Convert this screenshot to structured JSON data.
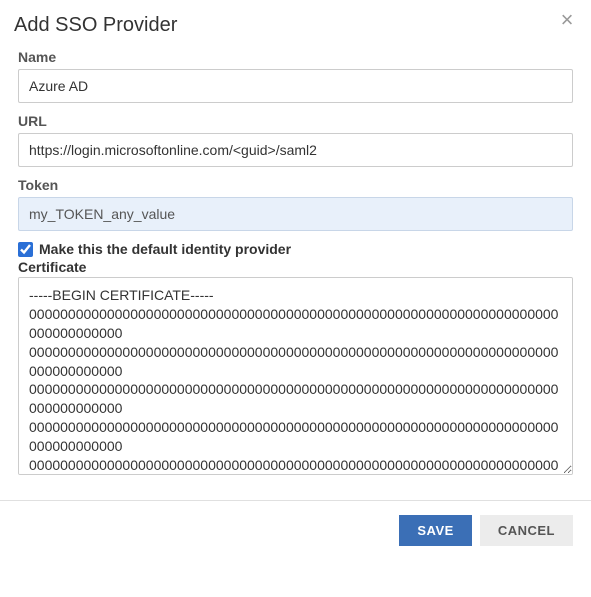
{
  "dialog": {
    "title": "Add SSO Provider"
  },
  "form": {
    "name_label": "Name",
    "name_value": "Azure AD",
    "url_label": "URL",
    "url_value": "https://login.microsoftonline.com/<guid>/saml2",
    "token_label": "Token",
    "token_value": "my_TOKEN_any_value",
    "default_checkbox_label": "Make this the default identity provider",
    "default_checked": true,
    "certificate_label": "Certificate",
    "certificate_value": "-----BEGIN CERTIFICATE-----\n00000000000000000000000000000000000000000000000000000000000000000000000000000000\n00000000000000000000000000000000000000000000000000000000000000000000000000000000\n00000000000000000000000000000000000000000000000000000000000000000000000000000000\n00000000000000000000000000000000000000000000000000000000000000000000000000000000\n00000000000000000000000000000000000000000000000000000000000000000000000000000000\n00000000000000000000000000000000000000000000000000000000000000000000000000000000\n00000000000000000000000000000000000000000000000000000000000000000000000000000000\n-----END CERTIFICATE-----"
  },
  "footer": {
    "save_label": "SAVE",
    "cancel_label": "CANCEL"
  }
}
